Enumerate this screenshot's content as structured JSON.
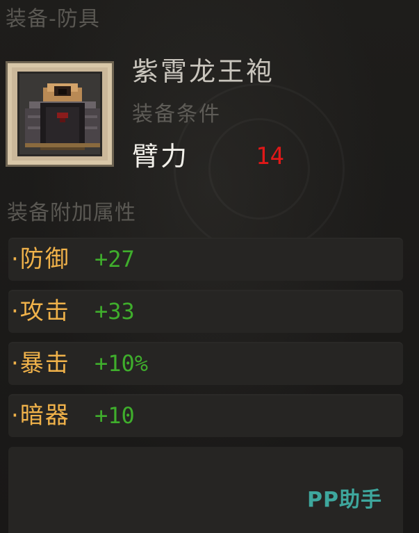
{
  "header": {
    "title": "装备-防具"
  },
  "item": {
    "name": "紫霄龙王袍",
    "icon": "robe-armor-icon",
    "requirement_label": "装备条件",
    "requirement_stat": "臂力",
    "requirement_value": "14"
  },
  "attributes": {
    "title": "装备附加属性",
    "rows": [
      {
        "name": "·防御",
        "value": "+27"
      },
      {
        "name": "·攻击",
        "value": "+33"
      },
      {
        "name": "·暴击",
        "value": "+10%"
      },
      {
        "name": "·暗器",
        "value": "+10"
      }
    ]
  },
  "watermark": "PP助手",
  "colors": {
    "attribute_name": "#f0b24a",
    "attribute_value": "#3fae2c",
    "requirement_value": "#e01818",
    "watermark": "#3ea79d"
  }
}
